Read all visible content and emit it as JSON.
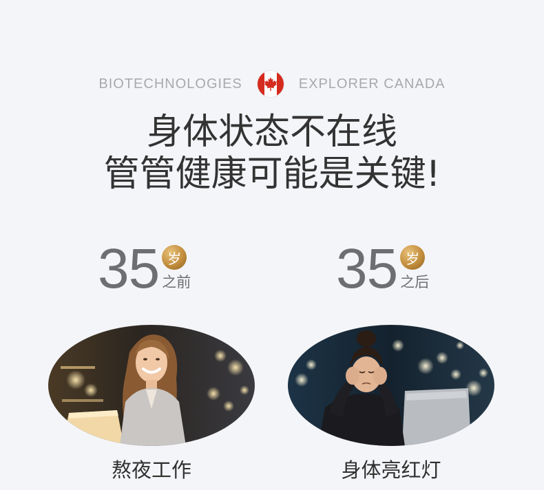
{
  "brand": {
    "left_text": "BIOTECHNOLOGIES",
    "right_text": "EXPLORER CANADA",
    "flag_icon": "canada-flag-icon",
    "flag_color": "#d52b1e"
  },
  "headline": {
    "line1": "身体状态不在线",
    "line2": "管管健康可能是关键!"
  },
  "comparison": [
    {
      "age": "35",
      "badge": "岁",
      "suffix": "之前",
      "caption": "熬夜工作",
      "image": "smiling-woman-at-laptop-night-office"
    },
    {
      "age": "35",
      "badge": "岁",
      "suffix": "之后",
      "caption": "身体亮红灯",
      "image": "stressed-woman-holding-head-at-laptop"
    }
  ],
  "colors": {
    "background": "#f4f5f8",
    "badge_gold": "#c28d3c",
    "age_gray": "#6d6e71",
    "brand_gray": "#a9a9ac"
  }
}
